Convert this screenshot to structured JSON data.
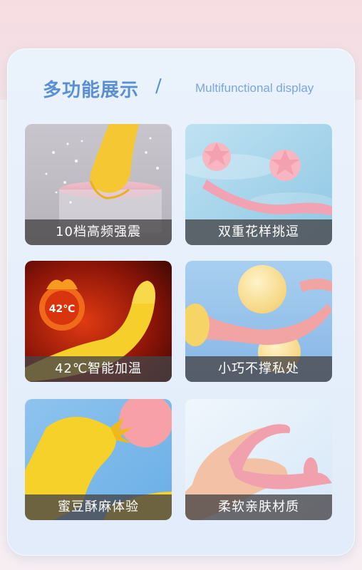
{
  "header": {
    "title_cn": "多功能展示",
    "separator": "/",
    "title_en": "Multifunctional display"
  },
  "features": [
    {
      "label": "10档高频强震",
      "icon": "vibration-splash-image"
    },
    {
      "label": "双重花样挑逗",
      "icon": "dual-stimulation-water-image"
    },
    {
      "label": "42℃智能加温",
      "icon": "heating-flame-image",
      "badge": "42℃"
    },
    {
      "label": "小巧不撑私处",
      "icon": "compact-size-image"
    },
    {
      "label": "蜜豆酥麻体验",
      "icon": "tongue-tip-image"
    },
    {
      "label": "柔软亲肤材质",
      "icon": "soft-silicone-hand-image"
    }
  ],
  "colors": {
    "accent": "#5b8fd4",
    "accent_light": "#7aa6de",
    "caption_bg": "#464446",
    "card_bg": "#e6eefb"
  }
}
